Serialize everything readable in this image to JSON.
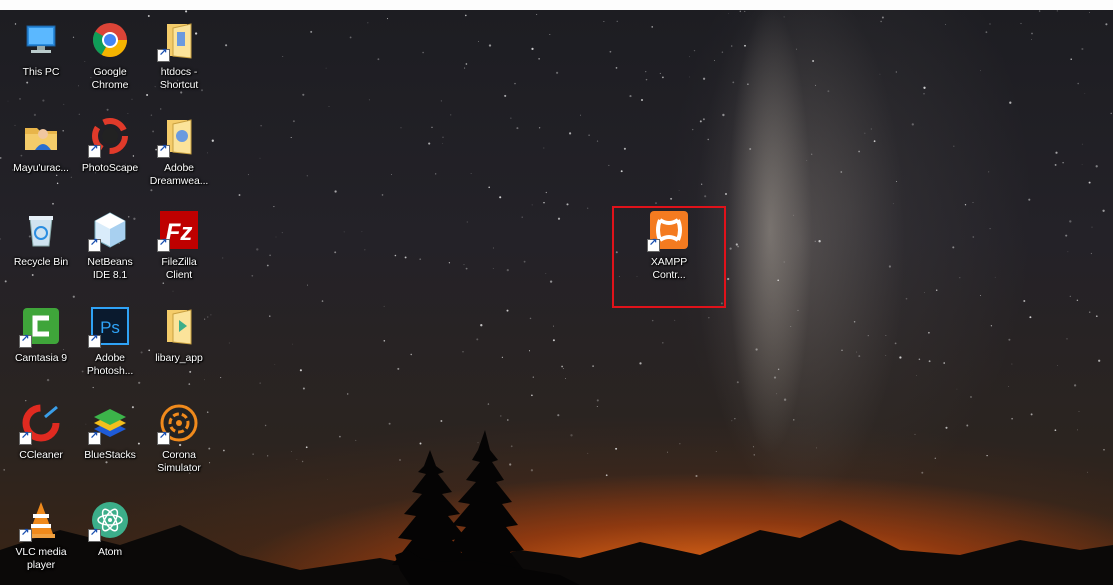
{
  "desktop": {
    "icons": [
      {
        "label": "This PC",
        "icon": "this-pc-icon",
        "shortcut": false
      },
      {
        "label": "Google Chrome",
        "icon": "chrome-icon",
        "shortcut": false
      },
      {
        "label": "htdocs - Shortcut",
        "icon": "folder-shortcut-icon",
        "shortcut": true
      },
      {
        "label": "Mayu'urac...",
        "icon": "user-folder-icon",
        "shortcut": false
      },
      {
        "label": "PhotoScape",
        "icon": "photoscape-icon",
        "shortcut": true
      },
      {
        "label": "Adobe Dreamwea...",
        "icon": "dreamweaver-icon",
        "shortcut": true
      },
      {
        "label": "Recycle Bin",
        "icon": "recycle-bin-icon",
        "shortcut": false
      },
      {
        "label": "NetBeans IDE 8.1",
        "icon": "netbeans-icon",
        "shortcut": true
      },
      {
        "label": "FileZilla Client",
        "icon": "filezilla-icon",
        "shortcut": true
      },
      {
        "label": "Camtasia 9",
        "icon": "camtasia-icon",
        "shortcut": true
      },
      {
        "label": "Adobe Photosh...",
        "icon": "photoshop-icon",
        "shortcut": true
      },
      {
        "label": "libary_app",
        "icon": "folder-icon",
        "shortcut": false
      },
      {
        "label": "CCleaner",
        "icon": "ccleaner-icon",
        "shortcut": true
      },
      {
        "label": "BlueStacks",
        "icon": "bluestacks-icon",
        "shortcut": true
      },
      {
        "label": "Corona Simulator",
        "icon": "corona-simulator-icon",
        "shortcut": true
      },
      {
        "label": "VLC media player",
        "icon": "vlc-icon",
        "shortcut": true
      },
      {
        "label": "Atom",
        "icon": "atom-icon",
        "shortcut": true
      },
      {
        "label": "XAMPP Contr...",
        "icon": "xampp-icon",
        "shortcut": true
      }
    ],
    "highlight_color": "#e0121a"
  }
}
